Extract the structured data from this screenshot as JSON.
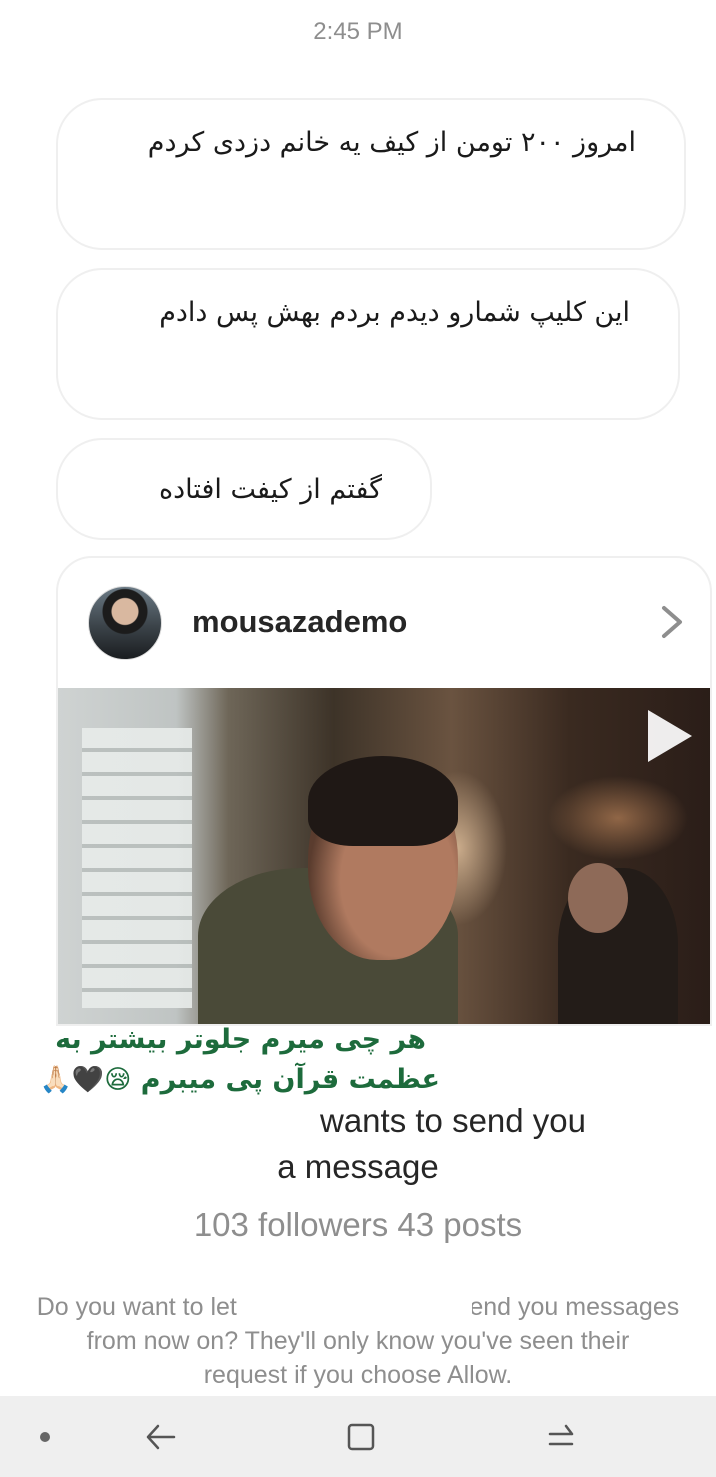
{
  "status": {
    "time": "2:45 PM"
  },
  "messages": [
    {
      "text": "امروز ۲۰۰ تومن از کیف یه خانم دزدی کردم"
    },
    {
      "text": "این کلیپ شمارو دیدم بردم بهش پس دادم"
    },
    {
      "text": "گفتم از کیفت افتاده"
    }
  ],
  "shared_post": {
    "username": "mousazademo",
    "media_type": "video"
  },
  "sticker_overlay": {
    "line1": "هر چی میرم جلوتر بیشتر به",
    "line2": "عظمت قرآن پی میبرم",
    "emojis": "😪🖤🙏🏻"
  },
  "request": {
    "title_suffix": "wants to send you",
    "title_line2": "a message",
    "stats": "103 followers 43 posts",
    "note_start": "Do you want to let",
    "note_end": "send you messages",
    "note_line2": "from now on? They'll only know you've seen their",
    "note_line3": "request if you choose Allow."
  },
  "icons": {
    "chevron": "chevron-right-icon",
    "play": "play-icon",
    "nav": [
      "dot-icon",
      "back-icon",
      "recent-apps-icon",
      "switch-icon"
    ]
  }
}
